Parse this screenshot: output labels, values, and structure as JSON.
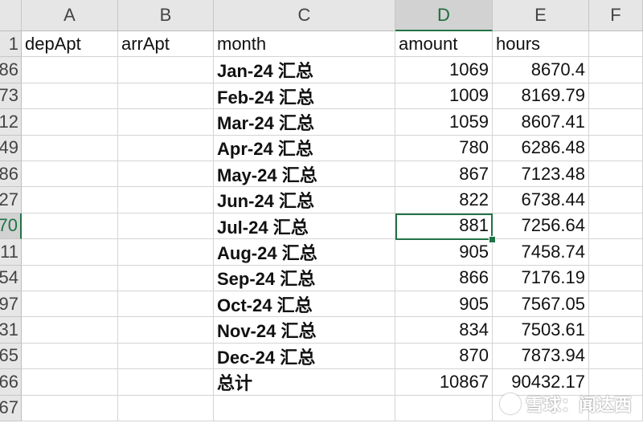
{
  "columns": [
    "A",
    "B",
    "C",
    "D",
    "E",
    "F"
  ],
  "selected_column": "D",
  "header_row": {
    "row_label": "1",
    "cells": [
      "depApt",
      "arrApt",
      "month",
      "amount",
      "hours",
      ""
    ]
  },
  "rows": [
    {
      "row_label": "86",
      "month": "Jan-24 汇总",
      "amount": "1069",
      "hours": "8670.4"
    },
    {
      "row_label": "73",
      "month": "Feb-24 汇总",
      "amount": "1009",
      "hours": "8169.79"
    },
    {
      "row_label": "12",
      "month": "Mar-24 汇总",
      "amount": "1059",
      "hours": "8607.41"
    },
    {
      "row_label": "49",
      "month": "Apr-24 汇总",
      "amount": "780",
      "hours": "6286.48"
    },
    {
      "row_label": "86",
      "month": "May-24 汇总",
      "amount": "867",
      "hours": "7123.48"
    },
    {
      "row_label": "27",
      "month": "Jun-24 汇总",
      "amount": "822",
      "hours": "6738.44"
    },
    {
      "row_label": "70",
      "month": "Jul-24 汇总",
      "amount": "881",
      "hours": "7256.64",
      "selected": true
    },
    {
      "row_label": "11",
      "month": "Aug-24 汇总",
      "amount": "905",
      "hours": "7458.74"
    },
    {
      "row_label": "54",
      "month": "Sep-24 汇总",
      "amount": "866",
      "hours": "7176.19"
    },
    {
      "row_label": "97",
      "month": "Oct-24 汇总",
      "amount": "905",
      "hours": "7567.05"
    },
    {
      "row_label": "31",
      "month": "Nov-24 汇总",
      "amount": "834",
      "hours": "7503.61"
    },
    {
      "row_label": "65",
      "month": "Dec-24 汇总",
      "amount": "870",
      "hours": "7873.94"
    },
    {
      "row_label": "66",
      "month": "总计",
      "amount": "10867",
      "hours": "90432.17",
      "grand_total": true
    },
    {
      "row_label": "67",
      "month": "",
      "amount": "",
      "hours": ""
    }
  ],
  "watermark": "雪球：闻达西",
  "colors": {
    "accent": "#217346",
    "header_bg": "#e6e6e6",
    "grid": "#d4d4d4"
  }
}
